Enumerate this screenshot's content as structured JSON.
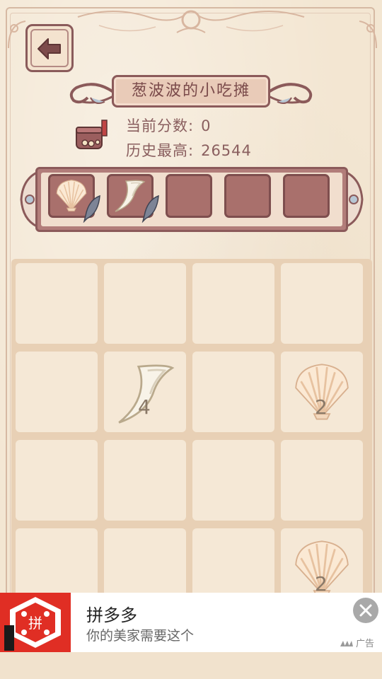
{
  "stall": {
    "title": "葱波波的小吃摊",
    "current_score_label": "当前分数:",
    "current_score": "0",
    "high_score_label": "历史最高:",
    "high_score": "26544"
  },
  "nav": {
    "back_icon": "arrow-left-icon"
  },
  "slots": [
    {
      "item": "scallop-shell"
    },
    {
      "item": "claw-tooth"
    },
    {
      "item": null
    },
    {
      "item": null
    },
    {
      "item": null
    }
  ],
  "board": {
    "rows": 4,
    "cols": 4,
    "tiles": [
      {
        "row": 1,
        "col": 1,
        "item": "claw-tooth",
        "number": "4"
      },
      {
        "row": 1,
        "col": 3,
        "item": "scallop-shell",
        "number": "2"
      },
      {
        "row": 3,
        "col": 3,
        "item": "scallop-shell",
        "number": "2"
      }
    ]
  },
  "ad": {
    "title": "拼多多",
    "subtitle": "你的美家需要这个",
    "label": "广告",
    "logo_text": "拼"
  },
  "colors": {
    "background": "#f3e6d2",
    "frame": "#8b5a5a",
    "slot": "#a9706c",
    "board_grid": "#e8d0b5",
    "cell": "#f5e8d6",
    "ad_brand": "#e02e24"
  }
}
